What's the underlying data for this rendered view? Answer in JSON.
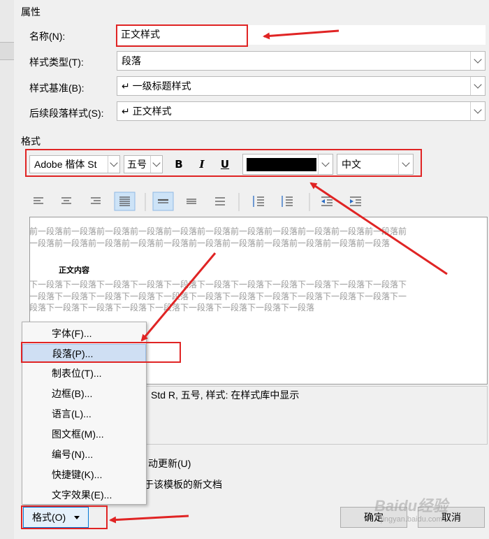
{
  "properties": {
    "group_title": "属性",
    "name_label": "名称(N):",
    "name_value": "正文样式",
    "type_label": "样式类型(T):",
    "type_value": "段落",
    "based_on_label": "样式基准(B):",
    "based_on_value": "↵ 一级标题样式",
    "following_label": "后续段落样式(S):",
    "following_value": "↵ 正文样式"
  },
  "format": {
    "group_title": "格式",
    "font": "Adobe 楷体 St",
    "size": "五号",
    "bold": "B",
    "italic": "I",
    "underline": "U",
    "color": "#000000",
    "language": "中文"
  },
  "preview": {
    "before_text": "前一段落前一段落前一段落前一段落前一段落前一段落前一段落前一段落前一段落前一段落前一段落前一段落前一段落前一段落前一段落前一段落前一段落前一段落前一段落前一段落前一段落前一段落",
    "sample": "正文内容",
    "after_text": "下一段落下一段落下一段落下一段落下一段落下一段落下一段落下一段落下一段落下一段落下一段落下一段落下一段落下一段落下一段落下一段落下一段落下一段落下一段落下一段落下一段落下一段落下一段落下一段落下一段落下一段落下一段落下一段落下一段落下一段落下一段落"
  },
  "description": {
    "line1": "Std R, 五号, 样式: 在样式库中显示"
  },
  "options": {
    "auto_update": "动更新(U)",
    "template_docs": "于该模板的新文档"
  },
  "menu": {
    "items": [
      {
        "label": "字体(F)..."
      },
      {
        "label": "段落(P)..."
      },
      {
        "label": "制表位(T)..."
      },
      {
        "label": "边框(B)..."
      },
      {
        "label": "语言(L)..."
      },
      {
        "label": "图文框(M)..."
      },
      {
        "label": "编号(N)..."
      },
      {
        "label": "快捷键(K)..."
      },
      {
        "label": "文字效果(E)..."
      }
    ]
  },
  "buttons": {
    "format": "格式(O)",
    "ok": "确定",
    "cancel": "取消"
  },
  "watermark": {
    "brand": "Baidu经验",
    "url": "jingyan.baidu.com"
  },
  "colors": {
    "annotation_red": "#e02424",
    "highlight": "#cfdff3"
  }
}
